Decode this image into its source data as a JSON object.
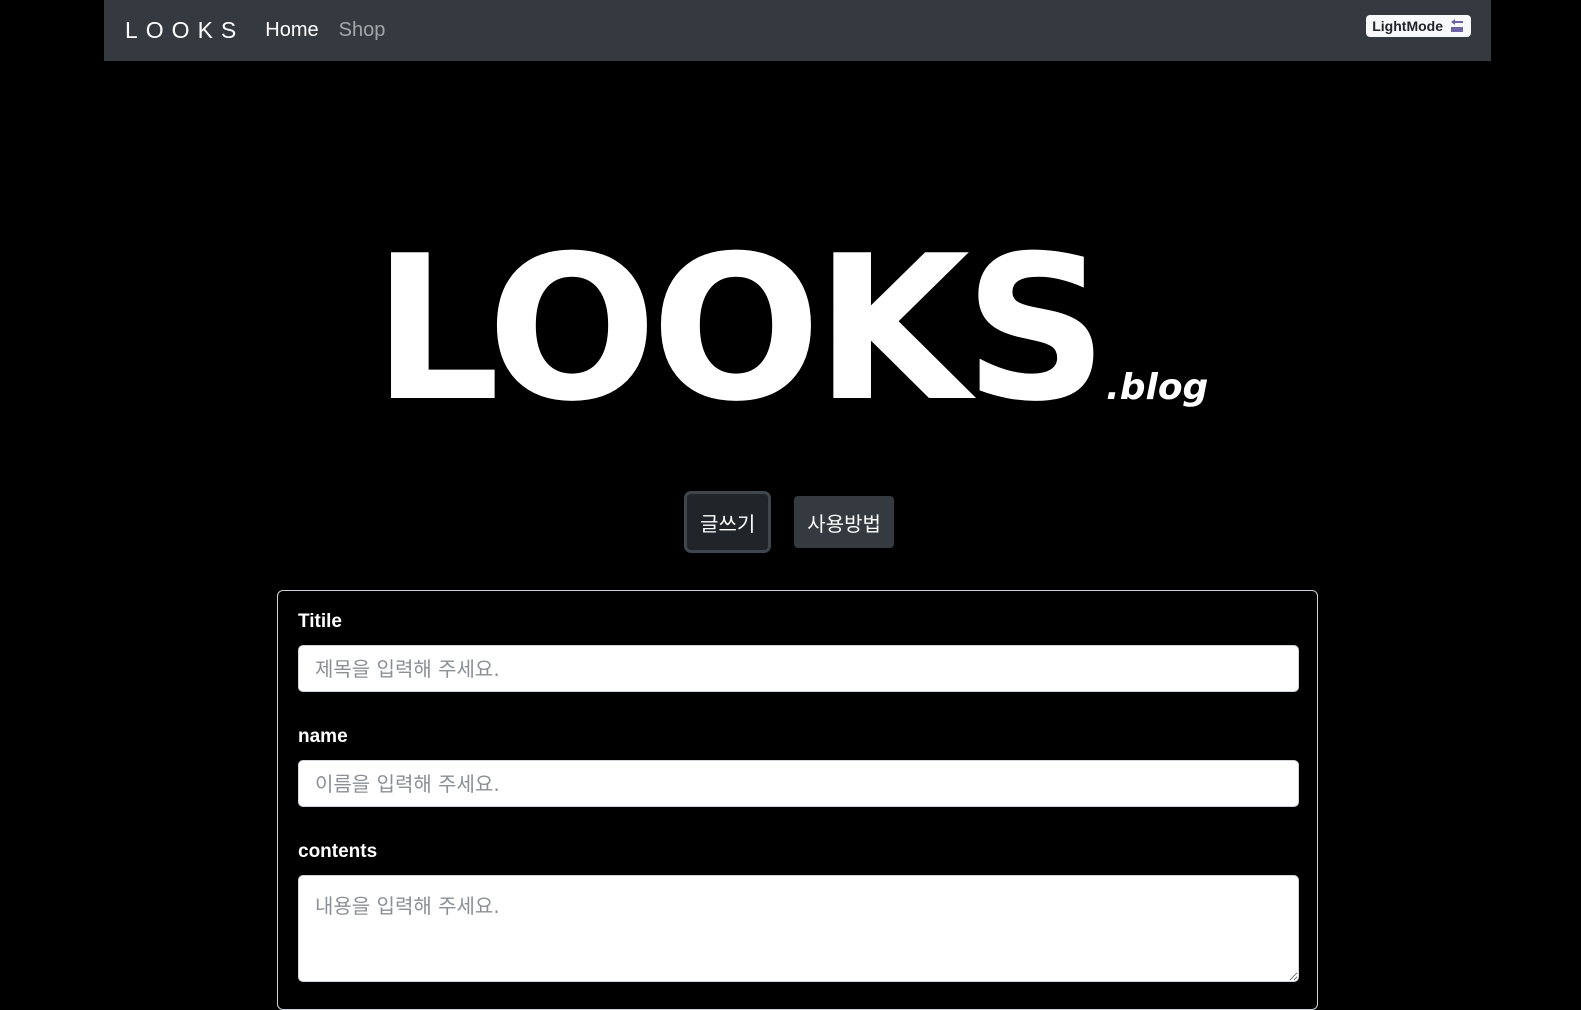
{
  "navbar": {
    "brand": "LOOKS",
    "links": [
      {
        "label": "Home"
      },
      {
        "label": "Shop"
      }
    ],
    "mode_toggle_label": "LightMode",
    "mode_toggle_icon": "mode-switch-icon"
  },
  "hero": {
    "logo": "LOOKS",
    "suffix": ".blog"
  },
  "actions": {
    "write_label": "글쓰기",
    "guide_label": "사용방법"
  },
  "form": {
    "title_label": "Titile",
    "title_placeholder": "제목을 입력해 주세요.",
    "name_label": "name",
    "name_placeholder": "이름을 입력해 주세요.",
    "contents_label": "contents",
    "contents_placeholder": "내용을 입력해 주세요."
  },
  "colors": {
    "page_bg": "#000000",
    "navbar_bg": "#343a40",
    "button_bg": "#343a40"
  }
}
